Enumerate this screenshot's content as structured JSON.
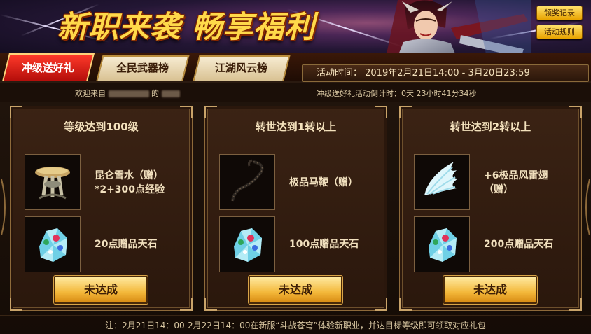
{
  "banner": {
    "title": "新职来袭 畅享福利",
    "btn_records": "领奖记录",
    "btn_rules": "活动规则"
  },
  "tabs": [
    {
      "label": "冲级送好礼",
      "active": true
    },
    {
      "label": "全民武器榜",
      "active": false
    },
    {
      "label": "江湖风云榜",
      "active": false
    }
  ],
  "activity_time": "活动时间：  2019年2月21日14:00 - 3月20日23:59",
  "welcome": {
    "prefix": "欢迎来自",
    "middle": "的"
  },
  "countdown": {
    "prefix": "冲级送好礼活动倒计时：",
    "value": "0天 23小时41分34秒"
  },
  "cards": [
    {
      "title": "等级达到100级",
      "items": [
        {
          "icon": "mushroom-table-icon",
          "text_1": "昆仑雪水（赠）",
          "text_2": "*2+300点经验"
        },
        {
          "icon": "sky-stone-icon",
          "text_1": "20点赠品天石",
          "text_2": ""
        }
      ],
      "button": "未达成"
    },
    {
      "title": "转世达到1转以上",
      "items": [
        {
          "icon": "whip-icon",
          "text_1": "极品马鞭（赠）",
          "text_2": ""
        },
        {
          "icon": "sky-stone-icon",
          "text_1": "100点赠品天石",
          "text_2": ""
        }
      ],
      "button": "未达成"
    },
    {
      "title": "转世达到2转以上",
      "items": [
        {
          "icon": "wings-icon",
          "text_1": "+6极品风雷翅",
          "text_2": "（赠）"
        },
        {
          "icon": "sky-stone-icon",
          "text_1": "200点赠品天石",
          "text_2": ""
        }
      ],
      "button": "未达成"
    }
  ],
  "footer": "注：2月21日14：00-2月22日14：00在新服“斗战苍穹”体验新职业，并达目标等级即可领取对应礼包",
  "colors": {
    "accent_gold": "#ffd94a",
    "tab_active": "#d8161a",
    "panel_bg": "#3b2314"
  }
}
